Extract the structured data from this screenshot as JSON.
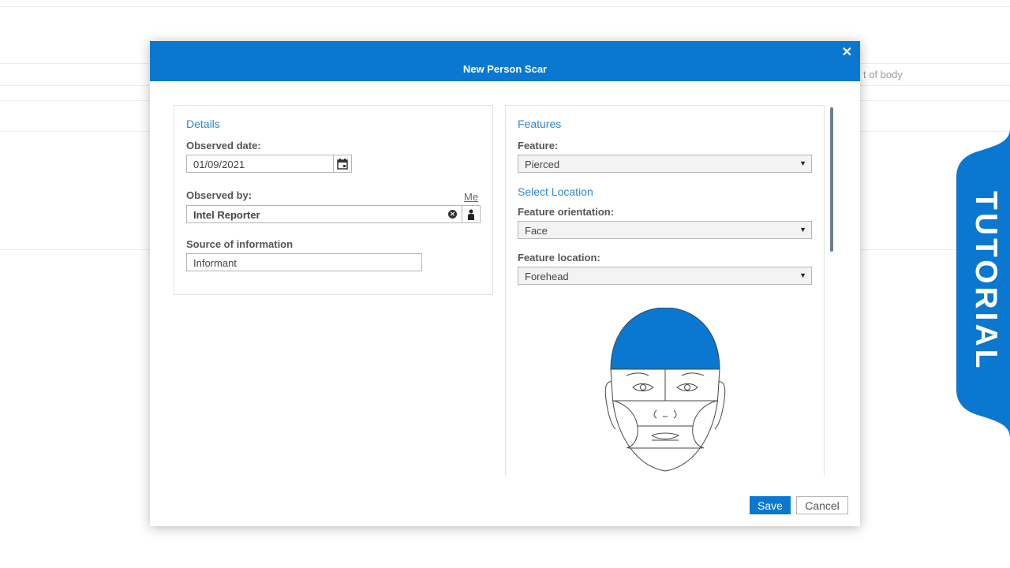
{
  "background": {
    "partial_text": "t of body"
  },
  "tutorial_tab": {
    "label": "TUTORIAL",
    "color": "#0a78d1"
  },
  "modal": {
    "title": "New Person Scar",
    "close_icon": "close-icon",
    "header_color": "#0a78d1",
    "details": {
      "heading": "Details",
      "observed_date": {
        "label": "Observed date:",
        "value": "01/09/2021",
        "icon": "calendar-icon"
      },
      "observed_by": {
        "label": "Observed by:",
        "me_link": "Me",
        "value": "Intel Reporter",
        "clear_icon": "clear-icon",
        "person_icon": "person-icon"
      },
      "source": {
        "label": "Source of information",
        "value": "Informant"
      }
    },
    "features": {
      "heading": "Features",
      "feature": {
        "label": "Feature:",
        "value": "Pierced"
      },
      "select_location_heading": "Select Location",
      "orientation": {
        "label": "Feature orientation:",
        "value": "Face"
      },
      "location": {
        "label": "Feature location:",
        "value": "Forehead"
      },
      "diagram_highlight_color": "#0a78d1"
    },
    "footer": {
      "save_label": "Save",
      "cancel_label": "Cancel"
    }
  }
}
